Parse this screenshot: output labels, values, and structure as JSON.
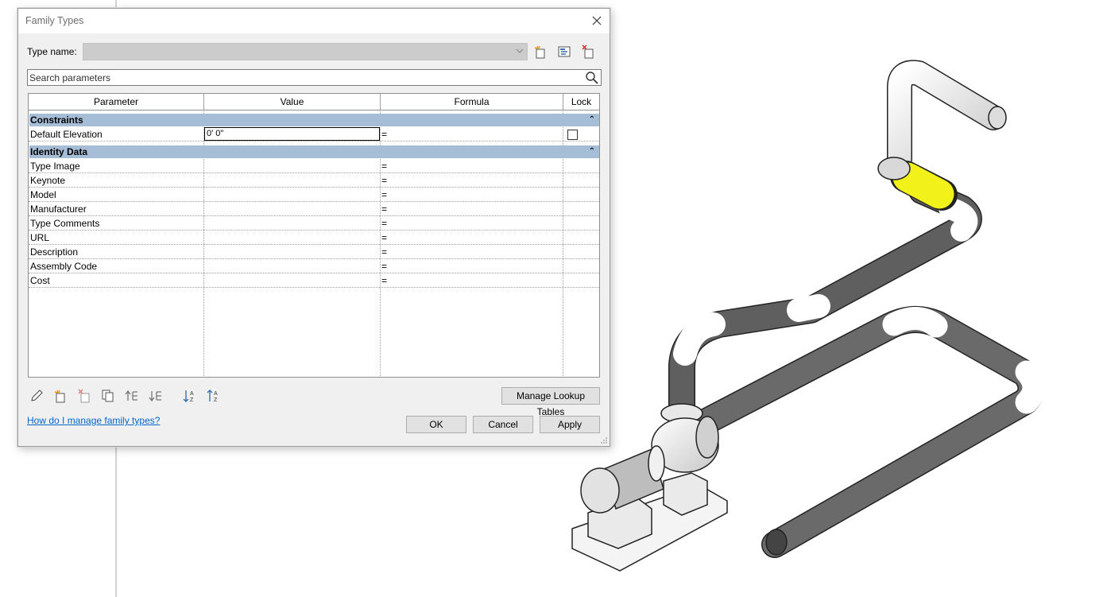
{
  "dialog": {
    "title": "Family Types",
    "type_name_label": "Type name:",
    "type_name_value": "",
    "search_placeholder": "Search parameters",
    "columns": [
      "Parameter",
      "Value",
      "Formula",
      "Lock"
    ],
    "groups": [
      {
        "name": "Constraints",
        "rows": [
          {
            "name": "Default Elevation",
            "value": "0'  0\"",
            "formula": "=",
            "lock": false
          }
        ]
      },
      {
        "name": "Identity Data",
        "rows": [
          {
            "name": "Type Image",
            "value": "",
            "formula": "="
          },
          {
            "name": "Keynote",
            "value": "",
            "formula": "="
          },
          {
            "name": "Model",
            "value": "",
            "formula": "="
          },
          {
            "name": "Manufacturer",
            "value": "",
            "formula": "="
          },
          {
            "name": "Type Comments",
            "value": "",
            "formula": "="
          },
          {
            "name": "URL",
            "value": "",
            "formula": "="
          },
          {
            "name": "Description",
            "value": "",
            "formula": "="
          },
          {
            "name": "Assembly Code",
            "value": "",
            "formula": "="
          },
          {
            "name": "Cost",
            "value": "",
            "formula": "="
          }
        ]
      }
    ],
    "collapse_glyph": "⌃",
    "manage_lookup_label": "Manage Lookup Tables",
    "help_link": "How do I manage family types?",
    "ok_label": "OK",
    "cancel_label": "Cancel",
    "apply_label": "Apply",
    "toolbar_icons": [
      "new-type-icon",
      "rename-type-icon",
      "delete-type-icon"
    ],
    "bottom_icons": [
      "edit-parameter-icon",
      "new-parameter-icon",
      "delete-parameter-icon",
      "copy-parameter-icon",
      "move-up-icon",
      "move-down-icon",
      "sort-ascending-icon",
      "sort-descending-icon"
    ],
    "group_header_color": "#a6bdd7",
    "link_color": "#0066cc"
  },
  "viewport": {
    "highlight_color": "#f2f21a",
    "pipe_color": "#6e6e6e"
  }
}
